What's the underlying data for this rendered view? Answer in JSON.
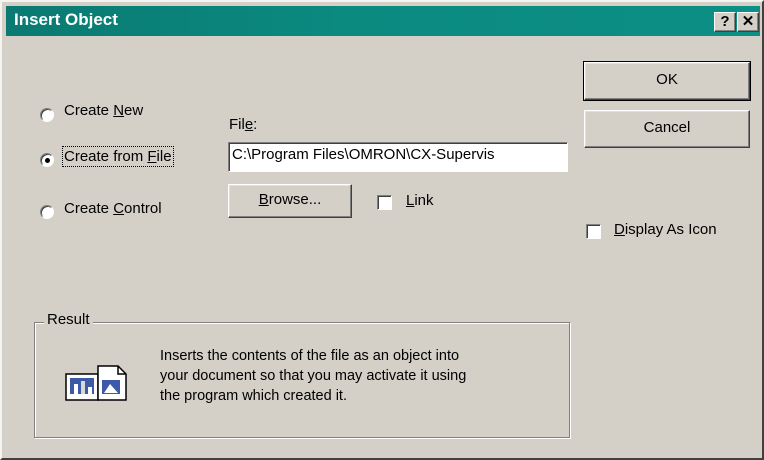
{
  "window": {
    "title": "Insert Object"
  },
  "titlebar": {
    "help": "?",
    "close": "✕"
  },
  "options": {
    "create_new": {
      "pre": "Create ",
      "key": "N",
      "post": "ew",
      "checked": false
    },
    "create_from_file": {
      "pre": "Create from ",
      "key": "F",
      "post": "ile",
      "checked": true
    },
    "create_control": {
      "pre": "Create ",
      "key": "C",
      "post": "ontrol",
      "checked": false
    }
  },
  "file": {
    "label_pre": "Fil",
    "label_key": "e",
    "label_post": ":",
    "value": "C:\\Program Files\\OMRON\\CX-Supervis"
  },
  "browse_button": {
    "key": "B",
    "post": "rowse..."
  },
  "link_checkbox": {
    "key": "L",
    "post": "ink",
    "checked": false
  },
  "buttons": {
    "ok": "OK",
    "cancel": "Cancel"
  },
  "display_as_icon": {
    "key": "D",
    "post": "isplay As Icon",
    "checked": false
  },
  "result": {
    "label": "Result",
    "lines": [
      "Inserts the contents of the file as an object into",
      "your document so that you may activate it using",
      "the program which created it."
    ]
  },
  "icons": {
    "result_icon": "document-chart-icon"
  }
}
